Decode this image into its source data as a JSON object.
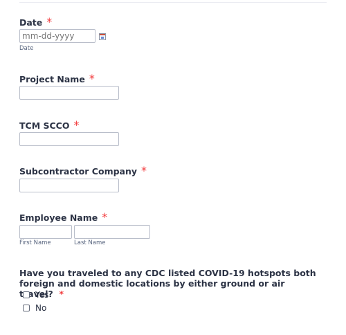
{
  "required_mark": "*",
  "date": {
    "label": "Date",
    "placeholder": "mm-dd-yyyy",
    "sublabel": "Date"
  },
  "project_name": {
    "label": "Project Name"
  },
  "tcm_scco": {
    "label": "TCM SCCO"
  },
  "subcontractor_company": {
    "label": "Subcontractor Company"
  },
  "employee_name": {
    "label": "Employee Name",
    "first_sublabel": "First Name",
    "last_sublabel": "Last Name"
  },
  "covid_question": {
    "label": "Have you traveled to any CDC listed COVID-19 hotspots both foreign and domestic locations by either ground or air travel?",
    "options": [
      "Yes",
      "No"
    ]
  },
  "colors": {
    "required": "#f23a3c",
    "label_text": "#2c3345",
    "input_border": "#b8bdc9"
  },
  "icons": {
    "calendar": "calendar-icon"
  }
}
